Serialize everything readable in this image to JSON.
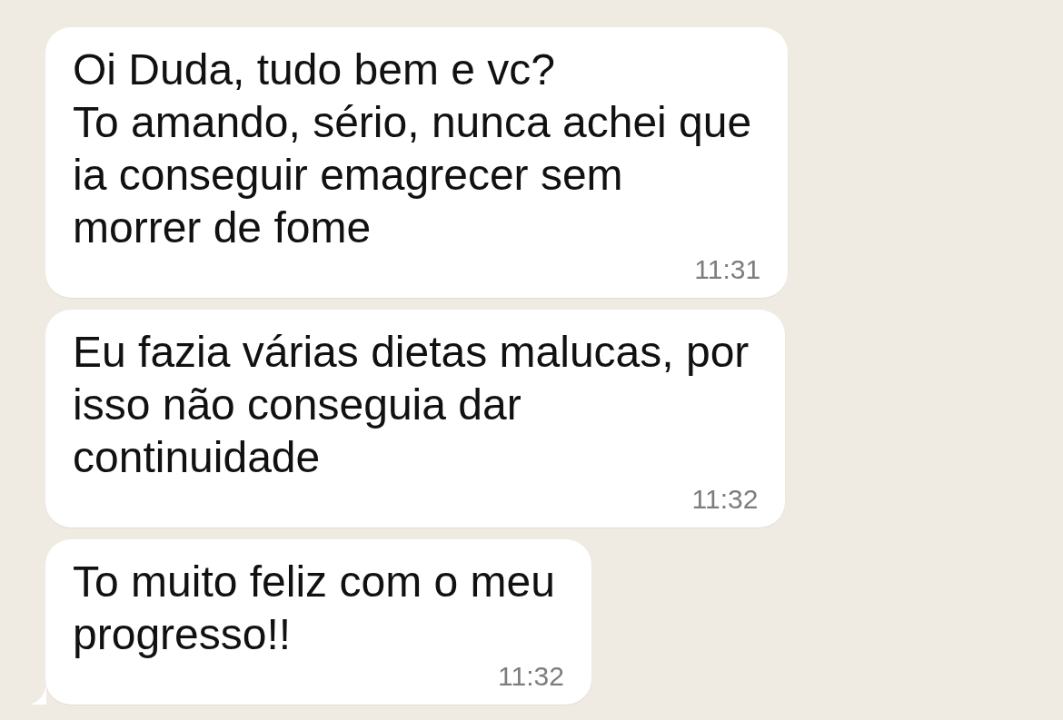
{
  "messages": [
    {
      "text": "Oi Duda, tudo bem e vc?\nTo amando, sério, nunca achei que\nia conseguir emagrecer sem\nmorrer de fome",
      "time": "11:31",
      "tail": false
    },
    {
      "text": "Eu fazia várias dietas malucas, por\nisso não conseguia dar\ncontinuidade",
      "time": "11:32",
      "tail": false
    },
    {
      "text": "To muito feliz com o meu\nprogresso!!",
      "time": "11:32",
      "tail": true
    }
  ]
}
